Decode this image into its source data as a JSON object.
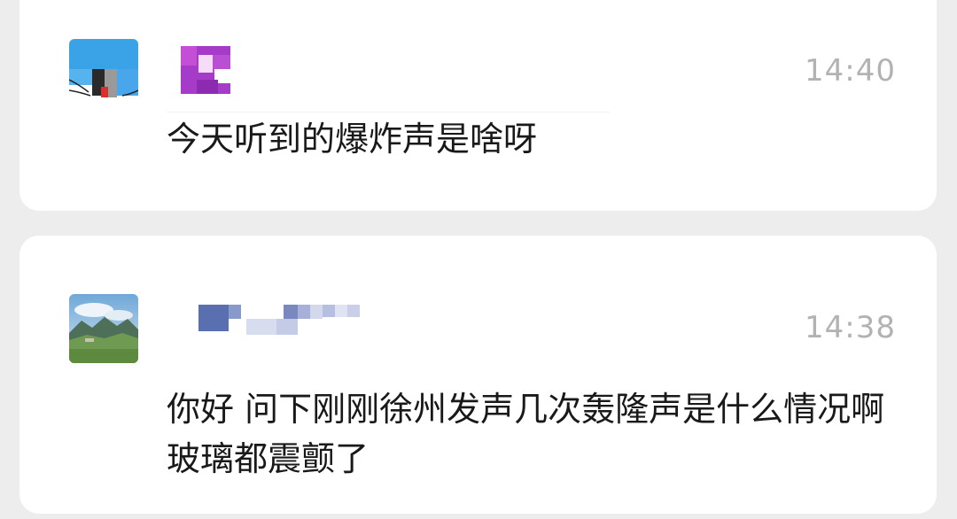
{
  "messages": [
    {
      "time": "14:40",
      "text": "今天听到的爆炸声是啥呀",
      "sender_name_visible": false,
      "avatar_icon": "cartoon-cat-avatar-pixelated"
    },
    {
      "time": "14:38",
      "text": "你好 问下刚刚徐州发声几次轰隆声是什么情况啊 玻璃都震颤了",
      "sender_name_visible": false,
      "avatar_icon": "mountain-landscape-avatar"
    }
  ],
  "colors": {
    "background": "#ededed",
    "card": "#ffffff",
    "time_text": "#b2b2b2",
    "message_text": "#191919"
  }
}
